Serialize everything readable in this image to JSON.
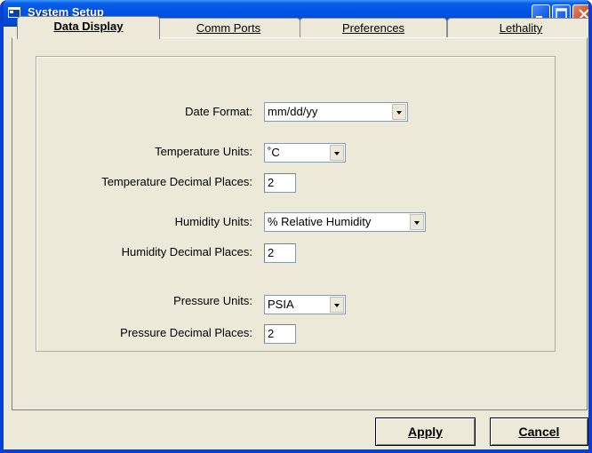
{
  "window": {
    "title": "System Setup",
    "icon": "app-icon",
    "controls": [
      "minimize-icon",
      "maximize-icon",
      "close-icon"
    ]
  },
  "tabs": [
    {
      "label": "Data Display",
      "active": true
    },
    {
      "label": "Comm Ports",
      "active": false
    },
    {
      "label": "Preferences",
      "active": false
    },
    {
      "label": "Lethality",
      "active": false
    }
  ],
  "form": {
    "date_format": {
      "label": "Date Format:",
      "value": "mm/dd/yy"
    },
    "temperature_units": {
      "label": "Temperature Units:",
      "value": "˚C"
    },
    "temperature_decimal_places": {
      "label": "Temperature Decimal Places:",
      "value": "2"
    },
    "humidity_units": {
      "label": "Humidity Units:",
      "value": "% Relative Humidity"
    },
    "humidity_decimal_places": {
      "label": "Humidity Decimal Places:",
      "value": "2"
    },
    "pressure_units": {
      "label": "Pressure Units:",
      "value": "PSIA"
    },
    "pressure_decimal_places": {
      "label": "Pressure Decimal Places:",
      "value": "2"
    }
  },
  "buttons": {
    "apply": "Apply",
    "cancel": "Cancel"
  },
  "colors": {
    "titlebar": "#0055e5",
    "window_bg": "#ece9d8",
    "close_button": "#d4512b"
  }
}
